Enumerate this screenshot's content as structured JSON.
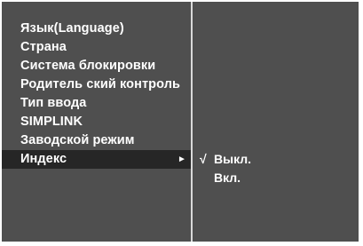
{
  "menu": {
    "items": [
      {
        "label": "Язык(Language)",
        "selected": false
      },
      {
        "label": "Страна",
        "selected": false
      },
      {
        "label": "Система блокировки",
        "selected": false
      },
      {
        "label": "Родитель ский контроль",
        "selected": false
      },
      {
        "label": "Тип ввода",
        "selected": false
      },
      {
        "label": "SIMPLINK",
        "selected": false
      },
      {
        "label": "Заводской режим",
        "selected": false
      },
      {
        "label": "Индекс",
        "selected": true
      }
    ],
    "arrow_icon": "►"
  },
  "submenu": {
    "check_icon": "√",
    "options": [
      {
        "label": "Выкл.",
        "checked": true
      },
      {
        "label": "Вкл.",
        "checked": false
      }
    ]
  },
  "colors": {
    "background": "#4f4f4f",
    "selected_row": "#262626",
    "divider": "#d9d9d9",
    "text": "#ffffff"
  }
}
